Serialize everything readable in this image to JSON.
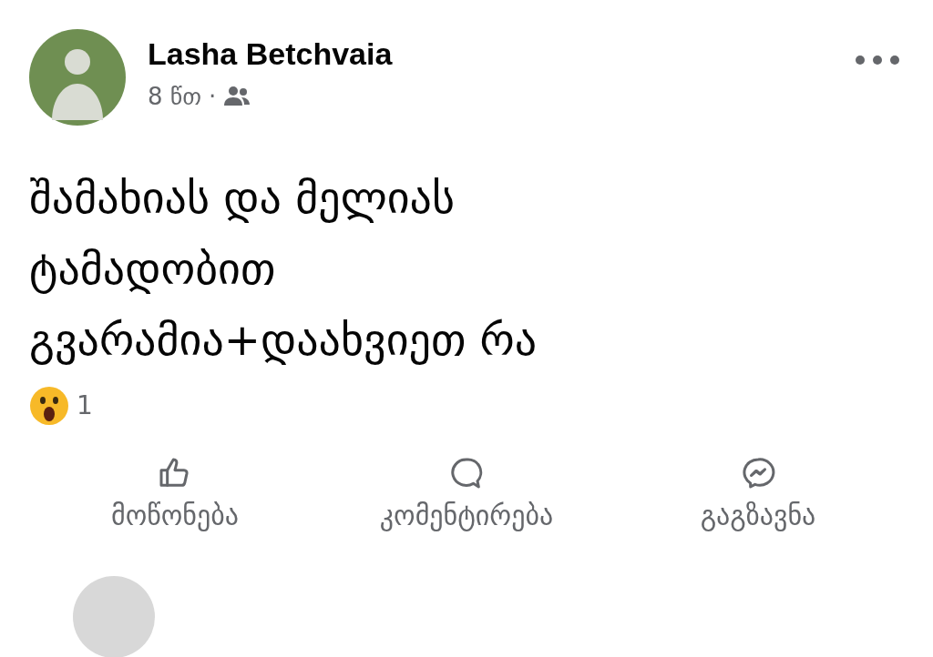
{
  "post": {
    "author": "Lasha Betchvaia",
    "time": "8 წთ",
    "separator": "·",
    "text_lines": [
      "შამახიას და მელიას",
      "ტამადობით",
      "გვარამია+დაახვიეთ რა"
    ],
    "reactions": {
      "count": "1"
    },
    "actions": [
      {
        "kind": "like",
        "label": "მოწონება"
      },
      {
        "kind": "comment",
        "label": "კომენტირება"
      },
      {
        "kind": "send",
        "label": "გაგზავნა"
      }
    ]
  }
}
